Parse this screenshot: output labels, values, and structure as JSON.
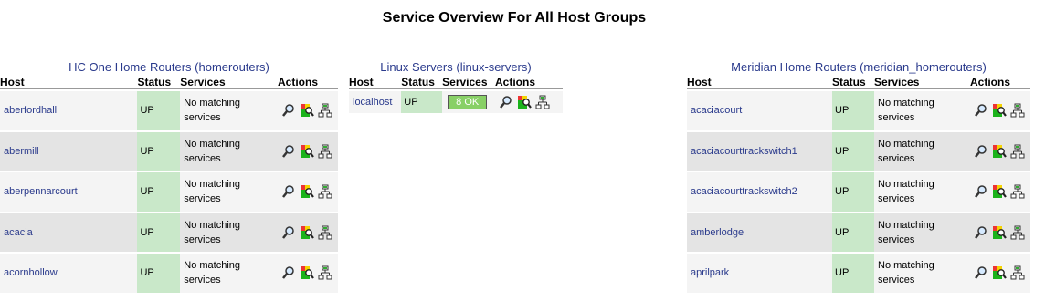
{
  "page_title": "Service Overview For All Host Groups",
  "columns": {
    "host": "Host",
    "status": "Status",
    "services": "Services",
    "actions": "Actions"
  },
  "groups": [
    {
      "alias": "HC One Home Routers",
      "name": "homerouters",
      "hosts": [
        {
          "name": "aberfordhall",
          "status": "UP",
          "services": "No matching services"
        },
        {
          "name": "abermill",
          "status": "UP",
          "services": "No matching services"
        },
        {
          "name": "aberpennarcourt",
          "status": "UP",
          "services": "No matching services"
        },
        {
          "name": "acacia",
          "status": "UP",
          "services": "No matching services"
        },
        {
          "name": "acornhollow",
          "status": "UP",
          "services": "No matching services"
        }
      ]
    },
    {
      "alias": "Linux Servers",
      "name": "linux-servers",
      "hosts": [
        {
          "name": "localhost",
          "status": "UP",
          "services_badge": "8 OK"
        }
      ]
    },
    {
      "alias": "Meridian Home Routers",
      "name": "meridian_homerouters",
      "hosts": [
        {
          "name": "acaciacourt",
          "status": "UP",
          "services": "No matching services"
        },
        {
          "name": "acaciacourttrackswitch1",
          "status": "UP",
          "services": "No matching services"
        },
        {
          "name": "acaciacourttrackswitch2",
          "status": "UP",
          "services": "No matching services"
        },
        {
          "name": "amberlodge",
          "status": "UP",
          "services": "No matching services"
        },
        {
          "name": "aprilpark",
          "status": "UP",
          "services": "No matching services"
        }
      ]
    }
  ],
  "icons": [
    "magnifier-icon",
    "status-detail-icon",
    "network-map-icon"
  ],
  "colors": {
    "link": "#2a3a8c",
    "status_up_bg": "#c9e8c9",
    "ok_badge_bg": "#88d066",
    "row_odd": "#f4f4f4",
    "row_even": "#e4e4e4"
  }
}
